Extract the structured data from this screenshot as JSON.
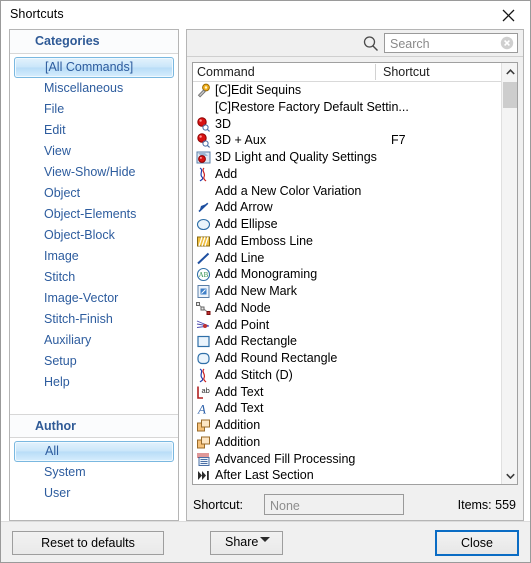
{
  "window": {
    "title": "Shortcuts",
    "close_icon": "close-icon"
  },
  "categories_panel": {
    "header": "Categories",
    "items": [
      {
        "label": "[All Commands]",
        "selected": true
      },
      {
        "label": "Miscellaneous",
        "selected": false
      },
      {
        "label": "File",
        "selected": false
      },
      {
        "label": "Edit",
        "selected": false
      },
      {
        "label": "View",
        "selected": false
      },
      {
        "label": "View-Show/Hide",
        "selected": false
      },
      {
        "label": "Object",
        "selected": false
      },
      {
        "label": "Object-Elements",
        "selected": false
      },
      {
        "label": "Object-Block",
        "selected": false
      },
      {
        "label": "Image",
        "selected": false
      },
      {
        "label": "Stitch",
        "selected": false
      },
      {
        "label": "Image-Vector",
        "selected": false
      },
      {
        "label": "Stitch-Finish",
        "selected": false
      },
      {
        "label": "Auxiliary",
        "selected": false
      },
      {
        "label": "Setup",
        "selected": false
      },
      {
        "label": "Help",
        "selected": false
      }
    ]
  },
  "author_panel": {
    "header": "Author",
    "items": [
      {
        "label": "All",
        "selected": true
      },
      {
        "label": "System",
        "selected": false
      },
      {
        "label": "User",
        "selected": false
      }
    ]
  },
  "search": {
    "icon": "search-icon",
    "placeholder": "Search",
    "value": "",
    "clear_icon": "clear-icon"
  },
  "command_list": {
    "columns": {
      "command": "Command",
      "shortcut": "Shortcut"
    },
    "rows": [
      {
        "icon": "key-icon",
        "label": "[C]Edit Sequins",
        "shortcut": ""
      },
      {
        "icon": "none",
        "label": "[C]Restore Factory Default Settin...",
        "shortcut": ""
      },
      {
        "icon": "sphere-search-icon",
        "label": "3D",
        "shortcut": ""
      },
      {
        "icon": "sphere-search-icon",
        "label": "3D + Aux",
        "shortcut": "F7"
      },
      {
        "icon": "sphere-light-icon",
        "label": "3D Light and Quality Settings",
        "shortcut": ""
      },
      {
        "icon": "stitch-add-icon",
        "label": "Add",
        "shortcut": ""
      },
      {
        "icon": "none",
        "label": "Add a New Color Variation",
        "shortcut": ""
      },
      {
        "icon": "arrow-icon",
        "label": "Add Arrow",
        "shortcut": ""
      },
      {
        "icon": "ellipse-icon",
        "label": "Add Ellipse",
        "shortcut": ""
      },
      {
        "icon": "emboss-line-icon",
        "label": "Add Emboss Line",
        "shortcut": ""
      },
      {
        "icon": "line-icon",
        "label": "Add Line",
        "shortcut": ""
      },
      {
        "icon": "monogram-icon",
        "label": "Add Monograming",
        "shortcut": ""
      },
      {
        "icon": "new-mark-icon",
        "label": "Add New Mark",
        "shortcut": ""
      },
      {
        "icon": "node-icon",
        "label": "Add Node",
        "shortcut": ""
      },
      {
        "icon": "point-icon",
        "label": "Add Point",
        "shortcut": ""
      },
      {
        "icon": "rectangle-icon",
        "label": "Add Rectangle",
        "shortcut": ""
      },
      {
        "icon": "round-rectangle-icon",
        "label": "Add Round Rectangle",
        "shortcut": ""
      },
      {
        "icon": "stitch-add-icon",
        "label": "Add Stitch (D)",
        "shortcut": ""
      },
      {
        "icon": "text-ab-icon",
        "label": "Add Text",
        "shortcut": ""
      },
      {
        "icon": "text-a-icon",
        "label": "Add Text",
        "shortcut": ""
      },
      {
        "icon": "addition-icon",
        "label": "Addition",
        "shortcut": ""
      },
      {
        "icon": "addition-icon",
        "label": "Addition",
        "shortcut": ""
      },
      {
        "icon": "advanced-fill-icon",
        "label": "Advanced Fill Processing",
        "shortcut": ""
      },
      {
        "icon": "after-last-section-icon",
        "label": "After Last Section",
        "shortcut": ""
      }
    ],
    "scrollbar": {
      "up_icon": "chevron-up-icon",
      "down_icon": "chevron-down-icon"
    }
  },
  "shortcut_bar": {
    "label": "Shortcut:",
    "placeholder": "None",
    "value": "",
    "items_count": "Items: 559"
  },
  "footer": {
    "reset_label": "Reset to defaults",
    "share_label": "Share",
    "share_caret_icon": "caret-down-icon",
    "close_label": "Close"
  },
  "colors": {
    "accent_blue": "#2d5c9e",
    "selection_border": "#7ab8e0",
    "default_button_border": "#0a6cc4"
  }
}
